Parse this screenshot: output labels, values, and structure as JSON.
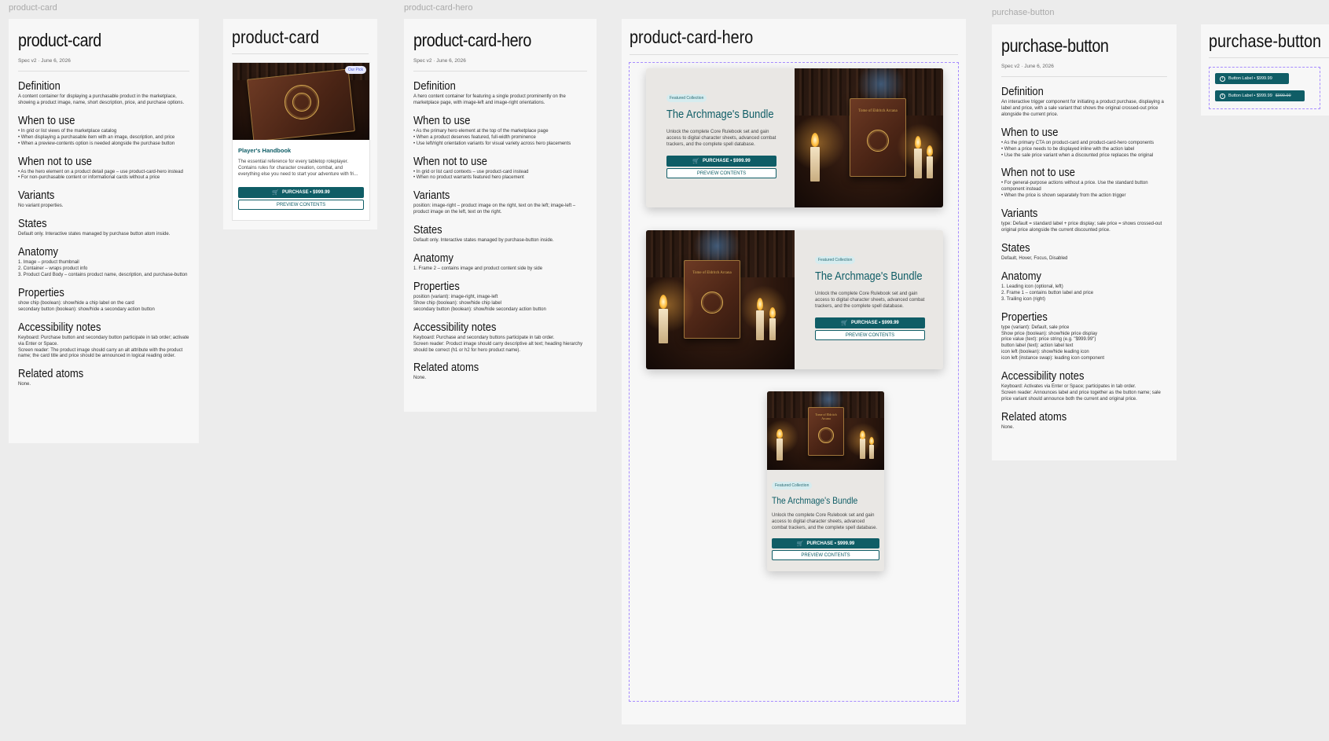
{
  "labels": {
    "product_card": "product-card",
    "product_card_hero": "product-card-hero",
    "purchase_button": "purchase-button"
  },
  "doc_card": {
    "title": "product-card",
    "meta": "Spec v2 · June 6, 2026",
    "definition_h": "Definition",
    "definition": "A content container for displaying a purchasable product in the marketplace, showing a product image, name, short description, price, and purchase options.",
    "when_h": "When to use",
    "when": "• In grid or list views of the marketplace catalog\n• When displaying a purchasable item with an image, description, and price\n• When a preview-contents option is needed alongside the purchase button",
    "whennot_h": "When not to use",
    "whennot": "• As the hero element on a product detail page – use product-card-hero instead\n• For non-purchasable content or informational cards without a price",
    "variants_h": "Variants",
    "variants": "No variant properties.",
    "states_h": "States",
    "states": "Default only. Interactive states managed by purchase button atom inside.",
    "anatomy_h": "Anatomy",
    "anatomy": "1. Image – product thumbnail\n2. Container – wraps product info\n3. Product Card Body – contains product name, description, and purchase-button",
    "props_h": "Properties",
    "props": "show chip (boolean): show/hide a chip label on the card\nsecondary button (boolean): show/hide a secondary action button",
    "a11y_h": "Accessibility notes",
    "a11y": "Keyboard: Purchase button and secondary button participate in tab order; activate via Enter or Space.\nScreen reader: The product image should carry an alt attribute with the product name; the card title and price should be announced in logical reading order.",
    "related_h": "Related atoms",
    "related": "None."
  },
  "card_demo": {
    "title": "product-card",
    "chip": "Our Pick",
    "name": "Player's Handbook",
    "desc": "The essential reference for every tabletop roleplayer. Contains rules for character creation, combat, and everything else you need to start your adventure with fri...",
    "purchase": "PURCHASE  •  $999.99",
    "preview": "PREVIEW CONTENTS"
  },
  "doc_hero": {
    "title": "product-card-hero",
    "meta": "Spec v2 · June 6, 2026",
    "definition_h": "Definition",
    "definition": "A hero content container for featuring a single product prominently on the marketplace page, with image-left and image-right orientations.",
    "when_h": "When to use",
    "when": "• As the primary hero element at the top of the marketplace page\n• When a product deserves featured, full-width prominence\n• Use left/right orientation variants for visual variety across hero placements",
    "whennot_h": "When not to use",
    "whennot": "• In grid or list card contexts – use product-card instead\n• When no product warrants featured hero placement",
    "variants_h": "Variants",
    "variants": "position: image-right – product image on the right, text on the left; image-left – product image on the left, text on the right.",
    "states_h": "States",
    "states": "Default only. Interactive states managed by purchase-button inside.",
    "anatomy_h": "Anatomy",
    "anatomy": "1. Frame 2 – contains image and product content side by side",
    "props_h": "Properties",
    "props": "position (variant): image-right, image-left\nShow chip (boolean): show/hide chip label\nsecondary button (boolean): show/hide secondary action button",
    "a11y_h": "Accessibility notes",
    "a11y": "Keyboard: Purchase and secondary buttons participate in tab order.\nScreen reader: Product image should carry descriptive alt text; heading hierarchy should be correct (h1 or h2 for hero product name).",
    "related_h": "Related atoms",
    "related": "None."
  },
  "hero_demo": {
    "title": "product-card-hero",
    "chip": "Featured Collection",
    "name": "The Archmage's Bundle",
    "desc": "Unlock the complete Core Rulebook set and gain access to digital character sheets, advanced combat trackers, and the complete spell database.",
    "purchase": "PURCHASE  •  $999.99",
    "preview": "PREVIEW CONTENTS",
    "book_text": "Tome of Eldritch Arcana"
  },
  "doc_button": {
    "title": "purchase-button",
    "meta": "Spec v2 · June 6, 2026",
    "definition_h": "Definition",
    "definition": "An interactive trigger component for initiating a product purchase, displaying a label and price, with a sale variant that shows the original crossed-out price alongside the current price.",
    "when_h": "When to use",
    "when": "• As the primary CTA on product-card and product-card-hero components\n• When a price needs to be displayed inline with the action label\n• Use the sale price variant when a discounted price replaces the original",
    "whennot_h": "When not to use",
    "whennot": "• For general-purpose actions without a price. Use the standard button component instead\n• When the price is shown separately from the action trigger",
    "variants_h": "Variants",
    "variants": "type: Default = standard label + price display; sale price = shows crossed-out original price alongside the current discounted price.",
    "states_h": "States",
    "states": "Default, Hover, Focus, Disabled",
    "anatomy_h": "Anatomy",
    "anatomy": "1. Leading icon (optional, left)\n2. Frame 1 – contains button label and price\n3. Trailing icon (right)",
    "props_h": "Properties",
    "props": "type (variant): Default, sale price\nShow price (boolean): show/hide price display\nprice value (text): price string (e.g. \"$999.99\")\nbutton label (text): action label text\nicon left (boolean): show/hide leading icon\nicon left (instance swap): leading icon component",
    "a11y_h": "Accessibility notes",
    "a11y": "Keyboard: Activates via Enter or Space; participates in tab order.\nScreen reader: Announces label and price together as the button name; sale price variant should announce both the current and original price.",
    "related_h": "Related atoms",
    "related": "None."
  },
  "button_demo": {
    "title": "purchase-button",
    "b1": "Button Label  •  $999.99",
    "b2": "Button Label  •  $999.99",
    "b2_old": "$999.99"
  },
  "colors": {
    "accent": "#0f5d66",
    "chip_bg": "#d6ecef",
    "canvas": "#ececec"
  }
}
